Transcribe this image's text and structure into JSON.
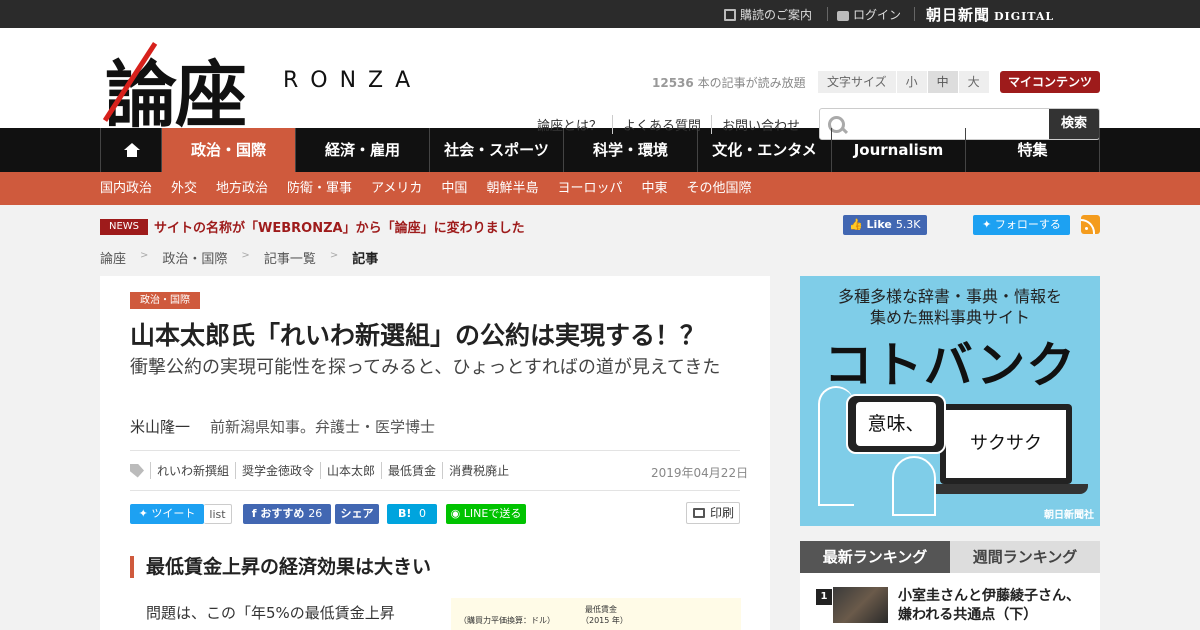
{
  "topbar": {
    "subscribe": "購読のご案内",
    "login": "ログイン",
    "asahi_logo": "朝日新聞",
    "asahi_digital": "DIGITAL"
  },
  "header": {
    "logo_kanji": "論座",
    "logo_latin": "RONZA",
    "read_count_number": "12536",
    "read_count_text": "本の記事が読み放題",
    "font_size_label": "文字サイズ",
    "font_sizes": [
      "小",
      "中",
      "大"
    ],
    "my_contents": "マイコンテンツ",
    "links": [
      "論座とは？",
      "よくある質問",
      "お問い合わせ"
    ],
    "search_placeholder": "",
    "search_button": "検索"
  },
  "nav": {
    "items": [
      "政治・国際",
      "経済・雇用",
      "社会・スポーツ",
      "科学・環境",
      "文化・エンタメ",
      "Journalism",
      "特集"
    ]
  },
  "subnav": {
    "items": [
      "国内政治",
      "外交",
      "地方政治",
      "防衛・軍事",
      "アメリカ",
      "中国",
      "朝鮮半島",
      "ヨーロッパ",
      "中東",
      "その他国際"
    ]
  },
  "news": {
    "badge": "NEWS",
    "text": "サイトの名称が「WEBRONZA」から「論座」に変わりました"
  },
  "social": {
    "fb_like": "Like",
    "fb_count": "5.3K",
    "tw_follow": "フォローする"
  },
  "breadcrumb": [
    "論座",
    "政治・国際",
    "記事一覧",
    "記事"
  ],
  "article": {
    "category": "政治・国際",
    "title": "山本太郎氏「れいわ新選組」の公約は実現する！？",
    "subtitle": "衝撃公約の実現可能性を探ってみると、ひょっとすればの道が見えてきた",
    "author": "米山隆一",
    "author_desc": "前新潟県知事。弁護士・医学博士",
    "tags": [
      "れいわ新撰組",
      "奨学金徳政令",
      "山本太郎",
      "最低賃金",
      "消費税廃止"
    ],
    "date": "2019年04月22日",
    "share": {
      "tweet": "ツイート",
      "list": "list",
      "fb_recommend": "おすすめ",
      "fb_count": "26",
      "fb_share": "シェア",
      "hatena": "B!",
      "hatena_count": "0",
      "line": "LINEで送る",
      "print": "印刷"
    },
    "heading": "最低賃金上昇の経済効果は大きい",
    "body": "問題は、この「年5%の最低賃金上昇",
    "table_img": {
      "title": "最低賃金",
      "unit": "（購買力平価換算：ドル）",
      "year": "（2015 年）"
    }
  },
  "ad": {
    "line1": "多種多様な辞書・事典・情報を",
    "line2": "集めた無料事典サイト",
    "big": "コトバンク",
    "phone_text": "意味、",
    "laptop_text": "サクサク",
    "credit": "朝日新聞社"
  },
  "ranking": {
    "tabs": [
      "最新ランキング",
      "週間ランキング"
    ],
    "items": [
      {
        "num": "1",
        "title": "小室圭さんと伊藤綾子さん、嫌われる共通点（下）"
      }
    ]
  },
  "colors": {
    "accent": "#cf5a3d",
    "dark_red": "#9e1b1b",
    "nav_bg": "#111111",
    "twitter": "#1da1f2",
    "facebook": "#4267b2",
    "line": "#00c300",
    "ad_bg": "#7fcde8"
  }
}
